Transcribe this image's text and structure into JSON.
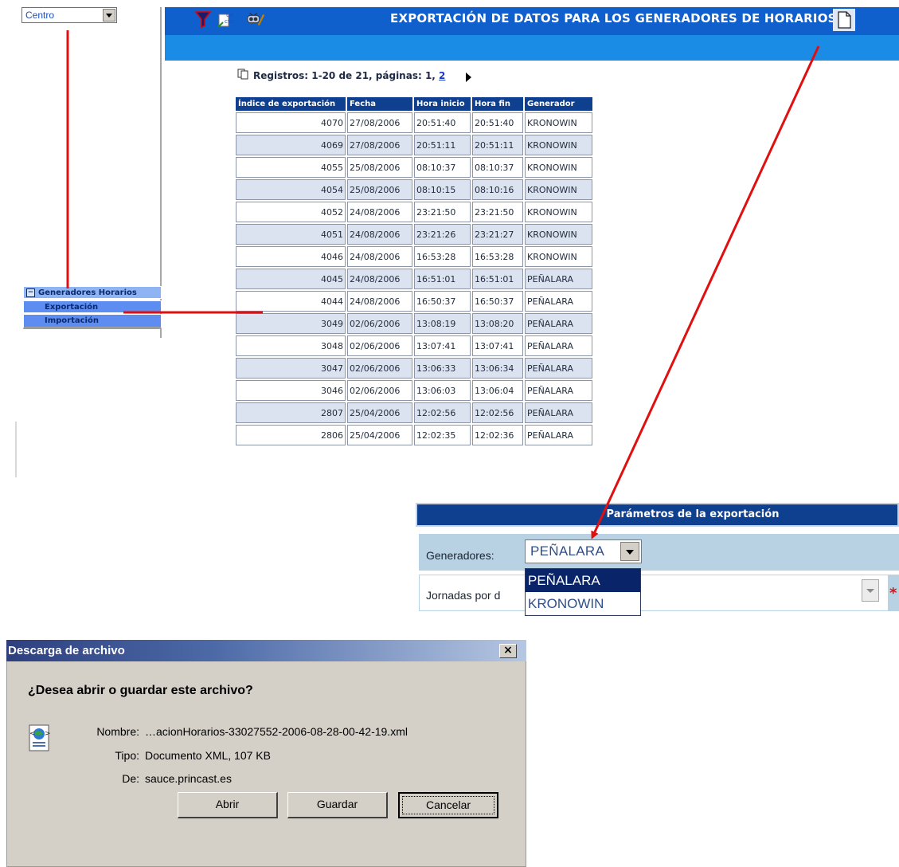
{
  "sidebar": {
    "center_select_value": "Centro",
    "menu_group_label": "Generadores Horarios",
    "menu_items": [
      "Exportación",
      "Importación"
    ]
  },
  "header": {
    "title": "EXPORTACIÓN DE DATOS PARA LOS GENERADORES DE HORARIOS",
    "tool_icons": [
      "filter-icon",
      "export-txt-csv-icon",
      "configure-icon"
    ],
    "page_icon": "document-icon"
  },
  "records": {
    "summary_prefix": "Registros: 1-20 de 21, páginas: 1, ",
    "page_link": "2"
  },
  "table": {
    "columns": [
      "Índice de exportación",
      "Fecha",
      "Hora inicio",
      "Hora fin",
      "Generador"
    ],
    "rows": [
      [
        "4070",
        "27/08/2006",
        "20:51:40",
        "20:51:40",
        "KRONOWIN"
      ],
      [
        "4069",
        "27/08/2006",
        "20:51:11",
        "20:51:11",
        "KRONOWIN"
      ],
      [
        "4055",
        "25/08/2006",
        "08:10:37",
        "08:10:37",
        "KRONOWIN"
      ],
      [
        "4054",
        "25/08/2006",
        "08:10:15",
        "08:10:16",
        "KRONOWIN"
      ],
      [
        "4052",
        "24/08/2006",
        "23:21:50",
        "23:21:50",
        "KRONOWIN"
      ],
      [
        "4051",
        "24/08/2006",
        "23:21:26",
        "23:21:27",
        "KRONOWIN"
      ],
      [
        "4046",
        "24/08/2006",
        "16:53:28",
        "16:53:28",
        "KRONOWIN"
      ],
      [
        "4045",
        "24/08/2006",
        "16:51:01",
        "16:51:01",
        "PEÑALARA"
      ],
      [
        "4044",
        "24/08/2006",
        "16:50:37",
        "16:50:37",
        "PEÑALARA"
      ],
      [
        "3049",
        "02/06/2006",
        "13:08:19",
        "13:08:20",
        "PEÑALARA"
      ],
      [
        "3048",
        "02/06/2006",
        "13:07:41",
        "13:07:41",
        "PEÑALARA"
      ],
      [
        "3047",
        "02/06/2006",
        "13:06:33",
        "13:06:34",
        "PEÑALARA"
      ],
      [
        "3046",
        "02/06/2006",
        "13:06:03",
        "13:06:04",
        "PEÑALARA"
      ],
      [
        "2807",
        "25/04/2006",
        "12:02:56",
        "12:02:56",
        "PEÑALARA"
      ],
      [
        "2806",
        "25/04/2006",
        "12:02:35",
        "12:02:36",
        "PEÑALARA"
      ]
    ]
  },
  "params": {
    "title": "Parámetros de la exportación",
    "generators_label": "Generadores:",
    "generators_value": "PEÑALARA",
    "generators_options": [
      "PEÑALARA",
      "KRONOWIN"
    ],
    "jornadas_label": "Jornadas por d",
    "required_mark": "*"
  },
  "dialog": {
    "title": "Descarga de archivo",
    "question": "¿Desea abrir o guardar este archivo?",
    "name_label": "Nombre:",
    "name_value": "…acionHorarios-33027552-2006-08-28-00-42-19.xml",
    "type_label": "Tipo:",
    "type_value": "Documento XML, 107 KB",
    "from_label": "De:",
    "from_value": "sauce.princast.es",
    "buttons": [
      "Abrir",
      "Guardar",
      "Cancelar"
    ],
    "close_label": "×"
  },
  "colors": {
    "header_blue": "#0f5fcc",
    "table_header": "#0f3f8f",
    "arrow_red": "#e01010"
  }
}
